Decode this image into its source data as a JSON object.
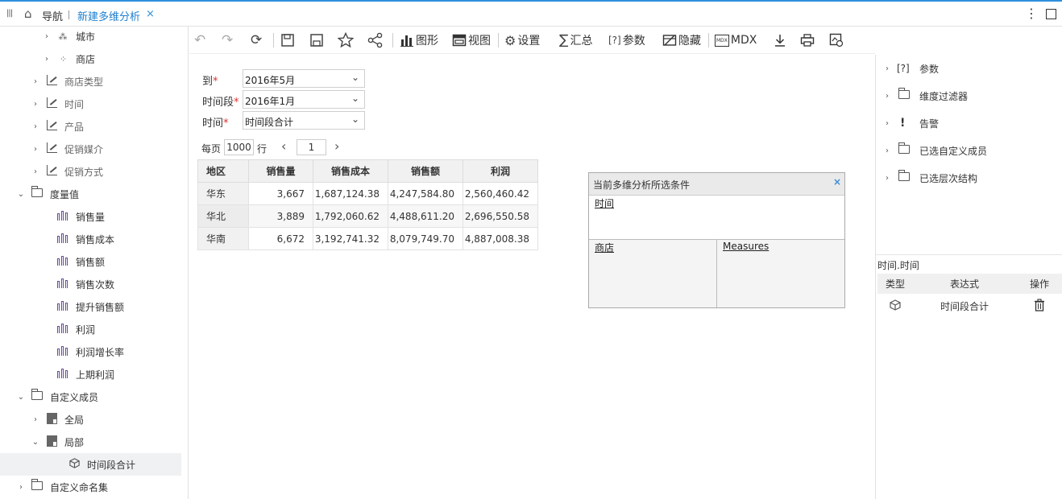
{
  "topbar": {
    "nav_label": "导航",
    "tab_label": "新建多维分析",
    "tab_close": "×",
    "more_glyph": "⋮"
  },
  "tree": [
    {
      "label": "城市",
      "icon": "hierarchy-icon",
      "indent": 2,
      "chevron": "›",
      "grey": false
    },
    {
      "label": "商店",
      "icon": "grid-icon",
      "indent": 2,
      "chevron": "›",
      "grey": false
    },
    {
      "label": "商店类型",
      "icon": "dimension-icon",
      "indent": 1,
      "chevron": "›",
      "grey": true
    },
    {
      "label": "时间",
      "icon": "dimension-icon",
      "indent": 1,
      "chevron": "›",
      "grey": true
    },
    {
      "label": "产品",
      "icon": "dimension-icon",
      "indent": 1,
      "chevron": "›",
      "grey": true
    },
    {
      "label": "促销媒介",
      "icon": "dimension-icon",
      "indent": 1,
      "chevron": "›",
      "grey": true
    },
    {
      "label": "促销方式",
      "icon": "dimension-icon",
      "indent": 1,
      "chevron": "›",
      "grey": true
    },
    {
      "label": "度量值",
      "icon": "folder-icon",
      "indent": 0,
      "chevron": "⌄",
      "grey": false
    },
    {
      "label": "销售量",
      "icon": "measure-icon",
      "indent": 2,
      "chevron": "",
      "grey": false
    },
    {
      "label": "销售成本",
      "icon": "measure-icon",
      "indent": 2,
      "chevron": "",
      "grey": false
    },
    {
      "label": "销售额",
      "icon": "measure-icon",
      "indent": 2,
      "chevron": "",
      "grey": false
    },
    {
      "label": "销售次数",
      "icon": "measure-icon",
      "indent": 2,
      "chevron": "",
      "grey": false
    },
    {
      "label": "提升销售额",
      "icon": "measure-icon",
      "indent": 2,
      "chevron": "",
      "grey": false
    },
    {
      "label": "利润",
      "icon": "measure-icon",
      "indent": 2,
      "chevron": "",
      "grey": false
    },
    {
      "label": "利润增长率",
      "icon": "measure-icon",
      "indent": 2,
      "chevron": "",
      "grey": false
    },
    {
      "label": "上期利润",
      "icon": "measure-icon",
      "indent": 2,
      "chevron": "",
      "grey": false
    },
    {
      "label": "自定义成员",
      "icon": "folder-icon",
      "indent": 0,
      "chevron": "⌄",
      "grey": false
    },
    {
      "label": "全局",
      "icon": "member-icon",
      "indent": 1,
      "chevron": "›",
      "grey": false
    },
    {
      "label": "局部",
      "icon": "member-icon",
      "indent": 1,
      "chevron": "⌄",
      "grey": false
    },
    {
      "label": "时间段合计",
      "icon": "cube-icon",
      "indent": 3,
      "chevron": "",
      "grey": false,
      "selected": true
    },
    {
      "label": "自定义命名集",
      "icon": "folder-icon",
      "indent": 0,
      "chevron": "›",
      "grey": false
    }
  ],
  "toolbar": {
    "undo": "↶",
    "redo": "↷",
    "refresh": "⟳",
    "chart_label": "图形",
    "view_label": "视图",
    "settings_label": "设置",
    "summary_label": "汇总",
    "param_label": "参数",
    "hide_label": "隐藏",
    "mdx_label": "MDX",
    "param_glyph": "[?]",
    "sum_glyph": "∑",
    "mdx_glyph": "MDX"
  },
  "params": {
    "to_label": "到",
    "to_value": "2016年5月",
    "period_label": "时间段",
    "period_value": "2016年1月",
    "time_label": "时间",
    "time_value": "时间段合计",
    "required_mark": "*",
    "dropdown_glyph": "⌄"
  },
  "pager": {
    "per_page_label": "每页",
    "per_page_value": "1000",
    "row_unit": "行",
    "prev": "‹",
    "next": "›",
    "page": "1"
  },
  "table": {
    "headers": [
      "地区",
      "销售量",
      "销售成本",
      "销售额",
      "利润"
    ],
    "rows": [
      [
        "华东",
        "3,667",
        "1,687,124.38",
        "4,247,584.80",
        "2,560,460.42"
      ],
      [
        "华北",
        "3,889",
        "1,792,060.62",
        "4,488,611.20",
        "2,696,550.58"
      ],
      [
        "华南",
        "6,672",
        "3,192,741.32",
        "8,079,749.70",
        "4,887,008.38"
      ]
    ],
    "more_glyph": "›"
  },
  "conditions": {
    "title": "当前多维分析所选条件",
    "close": "×",
    "top_link": "时间",
    "row_link": "商店",
    "col_link": "Measures"
  },
  "right_panel": {
    "items": [
      {
        "label": "参数",
        "icon": "param-icon",
        "glyph": "[?]"
      },
      {
        "label": "维度过滤器",
        "icon": "folder-icon",
        "glyph": ""
      },
      {
        "label": "告警",
        "icon": "alert-icon",
        "glyph": "!"
      },
      {
        "label": "已选自定义成员",
        "icon": "folder-icon",
        "glyph": ""
      },
      {
        "label": "已选层次结构",
        "icon": "folder-icon",
        "glyph": ""
      }
    ],
    "chevron": "›",
    "detail_title": "时间.时间",
    "col_type": "类型",
    "col_expr": "表达式",
    "col_ops": "操作",
    "row_expr": "时间段合计"
  }
}
